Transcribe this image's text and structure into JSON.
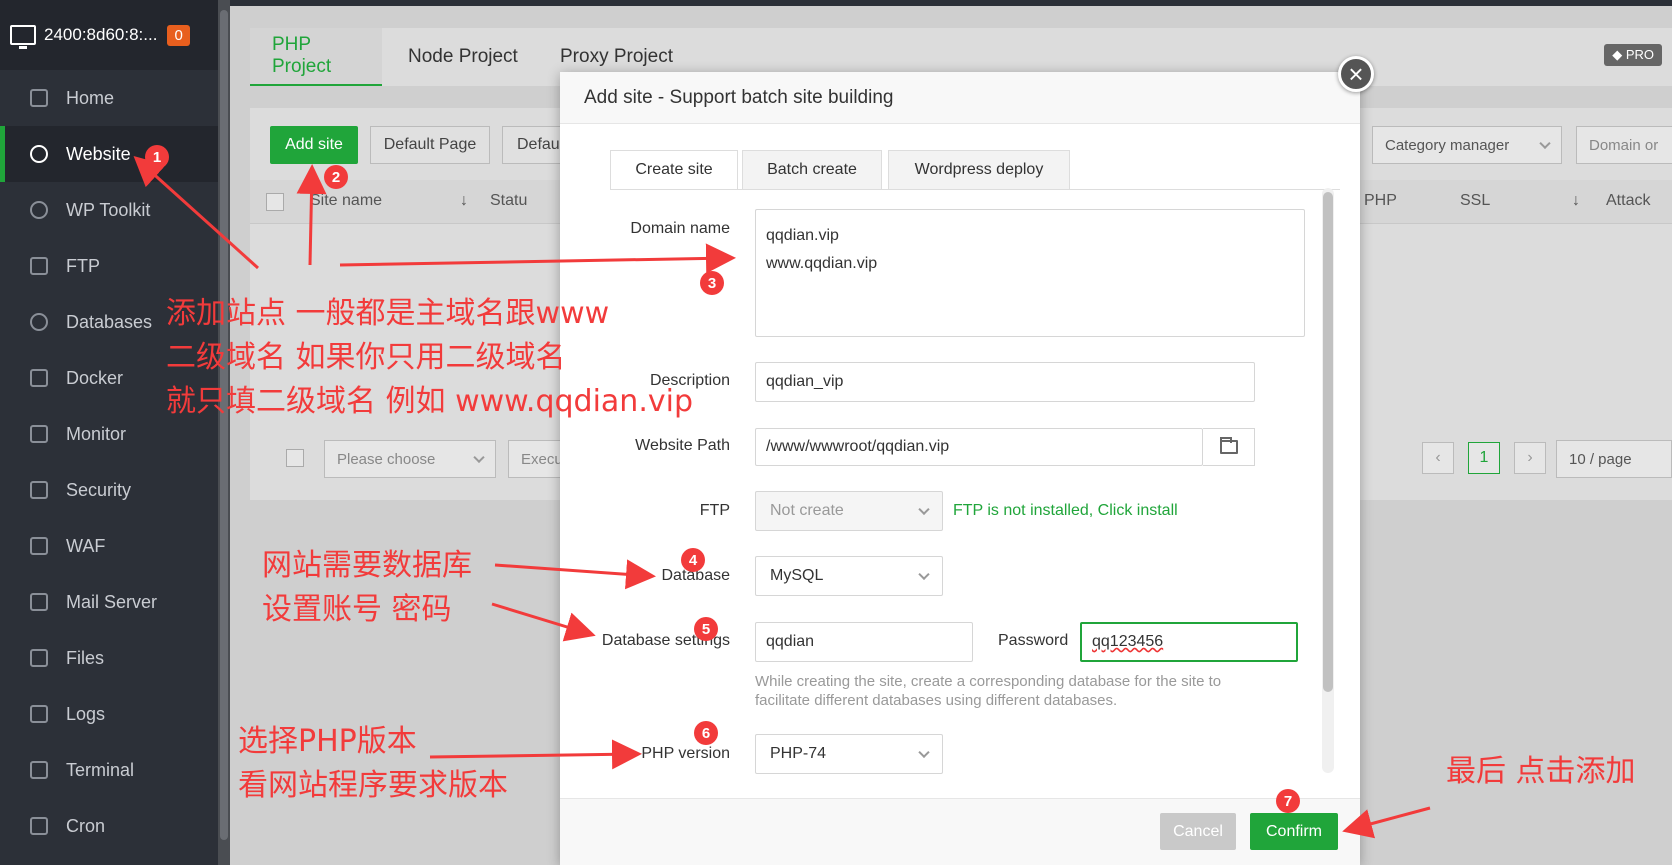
{
  "sidebar": {
    "server": "2400:8d60:8:...",
    "badge": "0",
    "items": [
      {
        "label": "Home"
      },
      {
        "label": "Website"
      },
      {
        "label": "WP Toolkit"
      },
      {
        "label": "FTP"
      },
      {
        "label": "Databases"
      },
      {
        "label": "Docker"
      },
      {
        "label": "Monitor"
      },
      {
        "label": "Security"
      },
      {
        "label": "WAF"
      },
      {
        "label": "Mail Server"
      },
      {
        "label": "Files"
      },
      {
        "label": "Logs"
      },
      {
        "label": "Terminal"
      },
      {
        "label": "Cron"
      }
    ]
  },
  "main": {
    "tabs": [
      "PHP Project",
      "Node Project",
      "Proxy Project"
    ],
    "pro": "PRO",
    "toolbar": {
      "add_site": "Add site",
      "default_page": "Default Page",
      "default_short": "Defau",
      "category_manager": "Category manager",
      "search_placeholder": "Domain or"
    },
    "columns": {
      "site_name": "Site name",
      "status": "Statu",
      "php": "PHP",
      "ssl": "SSL",
      "attack": "Attack"
    },
    "footer": {
      "please_choose": "Please choose",
      "execute": "Execu",
      "page": "1",
      "per_page": "10 / page"
    }
  },
  "modal": {
    "title": "Add site - Support batch site building",
    "tabs": [
      "Create site",
      "Batch create",
      "Wordpress deploy"
    ],
    "domain_label": "Domain name",
    "domain_line1": "qqdian.vip",
    "domain_line2": "www.qqdian.vip",
    "description_label": "Description",
    "description_value": "qqdian_vip",
    "path_label": "Website Path",
    "path_value": "/www/wwwroot/qqdian.vip",
    "ftp_label": "FTP",
    "ftp_value": "Not create",
    "ftp_hint": "FTP is not installed, Click install",
    "database_label": "Database",
    "database_value": "MySQL",
    "db_settings_label": "Database settings",
    "db_user": "qqdian",
    "password_label": "Password",
    "password_value": "qq123456",
    "db_hint": "While creating the site, create a corresponding database for the site to facilitate different databases using different databases.",
    "php_label": "PHP version",
    "php_value": "PHP-74",
    "cancel": "Cancel",
    "confirm": "Confirm",
    "close": "×"
  },
  "annotations": {
    "a1_line1": "添加站点 一般都是主域名跟www",
    "a1_line2": "二级域名  如果你只用二级域名",
    "a1_line3": "就只填二级域名 例如 www.qqdian.vip",
    "a2_line1": "网站需要数据库",
    "a2_line2": "设置账号 密码",
    "a3_line1": "选择PHP版本",
    "a3_line2": "看网站程序要求版本",
    "a4": "最后 点击添加",
    "n1": "1",
    "n2": "2",
    "n3": "3",
    "n4": "4",
    "n5": "5",
    "n6": "6",
    "n7": "7"
  },
  "colors": {
    "accent": "#20a53a",
    "annotation": "#f23b3b",
    "sidebar": "#2c3038"
  }
}
